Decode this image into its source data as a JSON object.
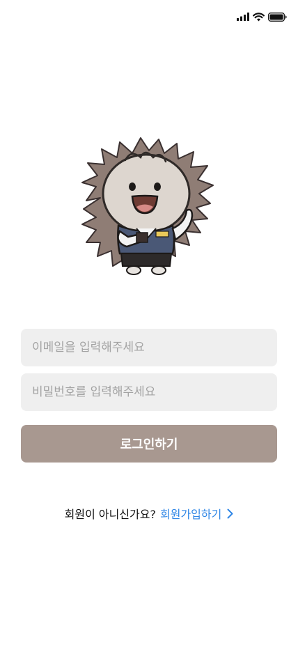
{
  "status_bar": {
    "icons": [
      "signal-icon",
      "wifi-icon",
      "battery-icon"
    ]
  },
  "mascot": {
    "description_icon": "hedgehog-mascot-icon"
  },
  "login_form": {
    "email_placeholder": "이메일을 입력해주세요",
    "email_value": "",
    "password_placeholder": "비밀번호를 입력해주세요",
    "password_value": "",
    "login_label": "로그인하기"
  },
  "signup": {
    "prompt": "회원이 아니신가요?",
    "link_label": "회원가입하기",
    "link_icon": "chevron-right-icon"
  },
  "colors": {
    "button_bg": "#a89890",
    "input_bg": "#efefef",
    "link": "#2f86e6"
  }
}
